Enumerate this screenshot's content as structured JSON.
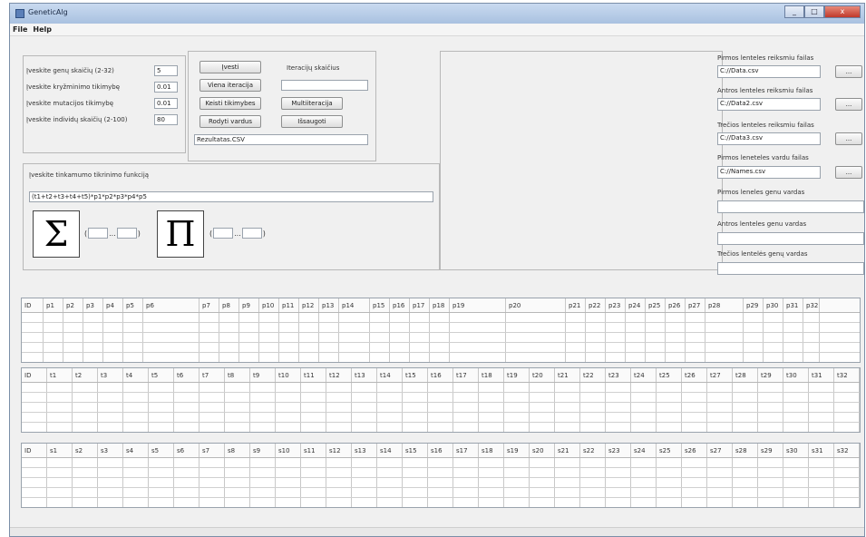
{
  "window": {
    "title": "GeneticAlg",
    "buttons": [
      "_",
      "□",
      "x"
    ]
  },
  "menu": [
    "File",
    "Help"
  ],
  "params": {
    "genes_label": "Įveskite genų skaičių (2-32)",
    "genes_value": "5",
    "crossover_label": "Įveskite kryžminimo tikimybę",
    "crossover_value": "0.01",
    "mutation_label": "Įveskite mutacijos tikimybę",
    "mutation_value": "0.01",
    "individuals_label": "Įveskite individų skaičių (2-100)",
    "individuals_value": "80"
  },
  "actions": {
    "ivesti": "Įvesti",
    "iterations_label": "Iteracijų skaičius",
    "iterations_value": "",
    "viena_iteracija": "Viena iteracija",
    "keisti_tikimybes": "Keisti tikimybes",
    "multiiteracija": "Multiiteracija",
    "rodyti_vardus": "Rodyti vardus",
    "issaugoti": "Išsaugoti",
    "result_file": "Rezultatas.CSV"
  },
  "fitness": {
    "label": "Įveskite tinkamumo tikrinimo funkciją",
    "value": "(t1+t2+t3+t4+t5)*p1*p2*p3*p4*p5",
    "sum_symbol": "Σ",
    "prod_symbol": "Π",
    "range_open": "(",
    "range_dots": "...",
    "range_close": ")"
  },
  "files": {
    "f1_label": "Pirmos lenteles reiksmiu failas",
    "f1_value": "C://Data.csv",
    "f2_label": "Antros lenteles reiksmiu failas",
    "f2_value": "C://Data2.csv",
    "f3_label": "Trečios lenteles reiksmiu failas",
    "f3_value": "C://Data3.csv",
    "names_label": "Pirmos leneteles vardu failas",
    "names_value": "C://Names.csv",
    "g1_label": "Pirmos leneles genu vardas",
    "g1_value": "",
    "g2_label": "Antros lenteles genu vardas",
    "g2_value": "",
    "g3_label": "Trečios lentelės genų vardas",
    "g3_value": "",
    "browse": "..."
  },
  "tables": {
    "p_cols": [
      "ID",
      "p1",
      "p2",
      "p3",
      "p4",
      "p5",
      "p6",
      "p7",
      "p8",
      "p9",
      "p10",
      "p11",
      "p12",
      "p13",
      "p14",
      "p15",
      "p16",
      "p17",
      "p18",
      "p19",
      "p20",
      "p21",
      "p22",
      "p23",
      "p24",
      "p25",
      "p26",
      "p27",
      "p28",
      "p29",
      "p30",
      "p31",
      "p32"
    ],
    "t_cols": [
      "ID",
      "t1",
      "t2",
      "t3",
      "t4",
      "t5",
      "t6",
      "t7",
      "t8",
      "t9",
      "t10",
      "t11",
      "t12",
      "t13",
      "t14",
      "t15",
      "t16",
      "t17",
      "t18",
      "t19",
      "t20",
      "t21",
      "t22",
      "t23",
      "t24",
      "t25",
      "t26",
      "t27",
      "t28",
      "t29",
      "t30",
      "t31",
      "t32"
    ],
    "s_cols": [
      "ID",
      "s1",
      "s2",
      "s3",
      "s4",
      "s5",
      "s6",
      "s7",
      "s8",
      "s9",
      "s10",
      "s11",
      "s12",
      "s13",
      "s14",
      "s15",
      "s16",
      "s17",
      "s18",
      "s19",
      "s20",
      "s21",
      "s22",
      "s23",
      "s24",
      "s25",
      "s26",
      "s27",
      "s28",
      "s29",
      "s30",
      "s31",
      "s32"
    ]
  }
}
